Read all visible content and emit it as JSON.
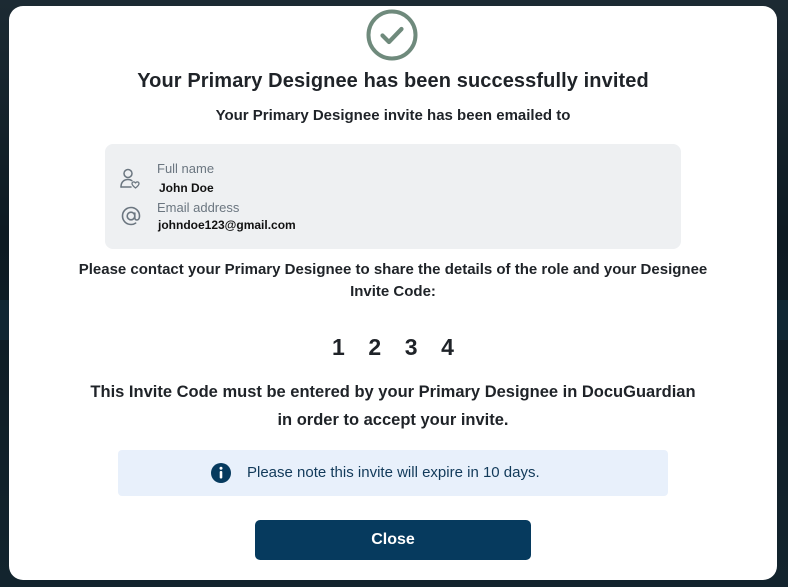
{
  "modal": {
    "title": "Your Primary Designee has been successfully invited",
    "subtitle": "Your Primary Designee invite has been emailed to",
    "status_icon": "check-circle-icon",
    "accent_color": "#6f8a7c"
  },
  "designee": {
    "full_name_label": "Full name",
    "full_name_value": "John Doe",
    "full_name_icon": "user-icon",
    "email_label": "Email address",
    "email_value": "johndoe123@gmail.com",
    "email_icon": "at-icon"
  },
  "instructions": {
    "contact_text": "Please contact your Primary Designee to share the details of the role and your Designee Invite Code:",
    "code_digits": [
      "1",
      "2",
      "3",
      "4"
    ],
    "invite_notice": "This Invite Code must be entered by your Primary Designee in DocuGuardian in order to accept your invite."
  },
  "expiry_banner": {
    "icon": "info-icon",
    "text": "Please note this invite will expire in 10 days.",
    "background_color": "#e8f0fb",
    "text_color": "#123a5a"
  },
  "actions": {
    "close_label": "Close",
    "button_color": "#063a5e"
  }
}
